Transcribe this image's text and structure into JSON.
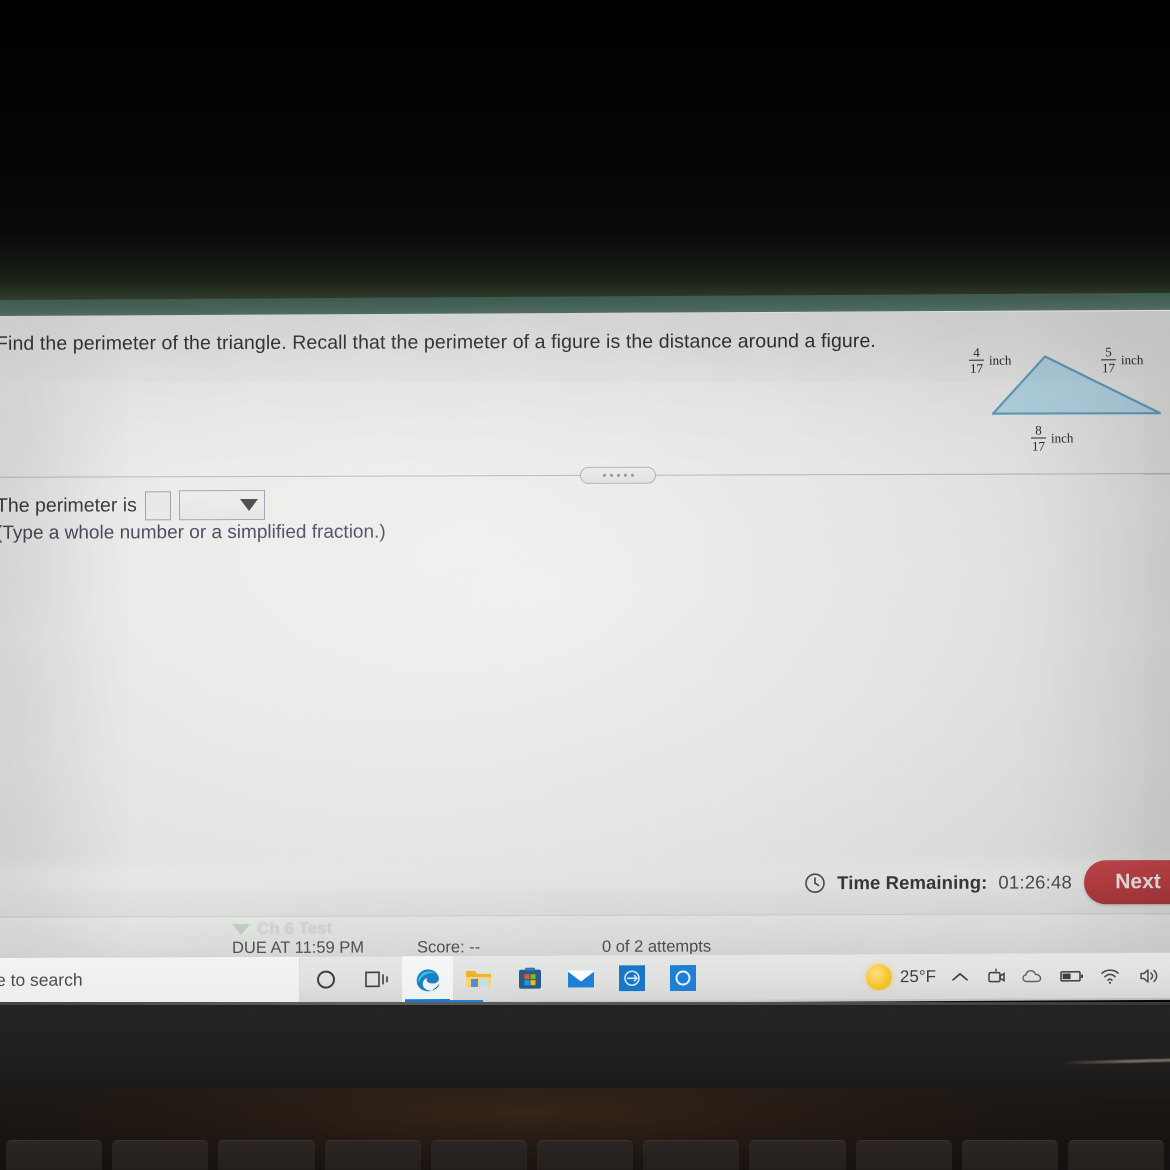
{
  "question": {
    "prompt": "Find the perimeter of the triangle. Recall that the perimeter of a figure is the distance around a figure."
  },
  "figure": {
    "type": "triangle",
    "shape_fill": "#a8cfe0",
    "shape_stroke": "#5b95b8",
    "sides": [
      {
        "position": "left",
        "numerator": "4",
        "denominator": "17",
        "unit": "inch"
      },
      {
        "position": "right",
        "numerator": "5",
        "denominator": "17",
        "unit": "inch"
      },
      {
        "position": "bottom",
        "numerator": "8",
        "denominator": "17",
        "unit": "inch"
      }
    ]
  },
  "answer": {
    "label": "The perimeter is",
    "value": "",
    "unit_select_value": "",
    "hint": "(Type a whole number or a simplified fraction.)"
  },
  "divider": {
    "handle_dots": 5
  },
  "status_bar": {
    "clock_icon": "clock-icon",
    "time_label": "Time Remaining:",
    "time_value": "01:26:48",
    "next_label": "Next",
    "next_color": "#bb3f43"
  },
  "assignment": {
    "title": "Ch 6 Test",
    "due": "DUE AT 11:59 PM",
    "score": "Score: --",
    "attempts": "0 of 2 attempts"
  },
  "taskbar": {
    "search_text": "e to search",
    "cortana_icon": "cortana-circle-icon",
    "taskview_icon": "task-view-icon",
    "apps": [
      {
        "name": "microsoft-edge",
        "active": true
      },
      {
        "name": "file-explorer",
        "active": false
      },
      {
        "name": "microsoft-store",
        "active": false
      },
      {
        "name": "mail",
        "active": false
      },
      {
        "name": "blue-app-one",
        "active": false
      },
      {
        "name": "blue-app-two",
        "active": false
      }
    ],
    "tray": {
      "weather_icon": "sun-icon",
      "weather_temp": "25°F",
      "chevron_icon": "chevron-up-icon",
      "camera_icon": "camera-icon",
      "onedrive_icon": "onedrive-cloud-icon",
      "battery_icon": "battery-icon",
      "wifi_icon": "wifi-icon",
      "volume_icon": "volume-icon"
    }
  },
  "cursor": {
    "icon": "mouse-pointer-icon"
  }
}
